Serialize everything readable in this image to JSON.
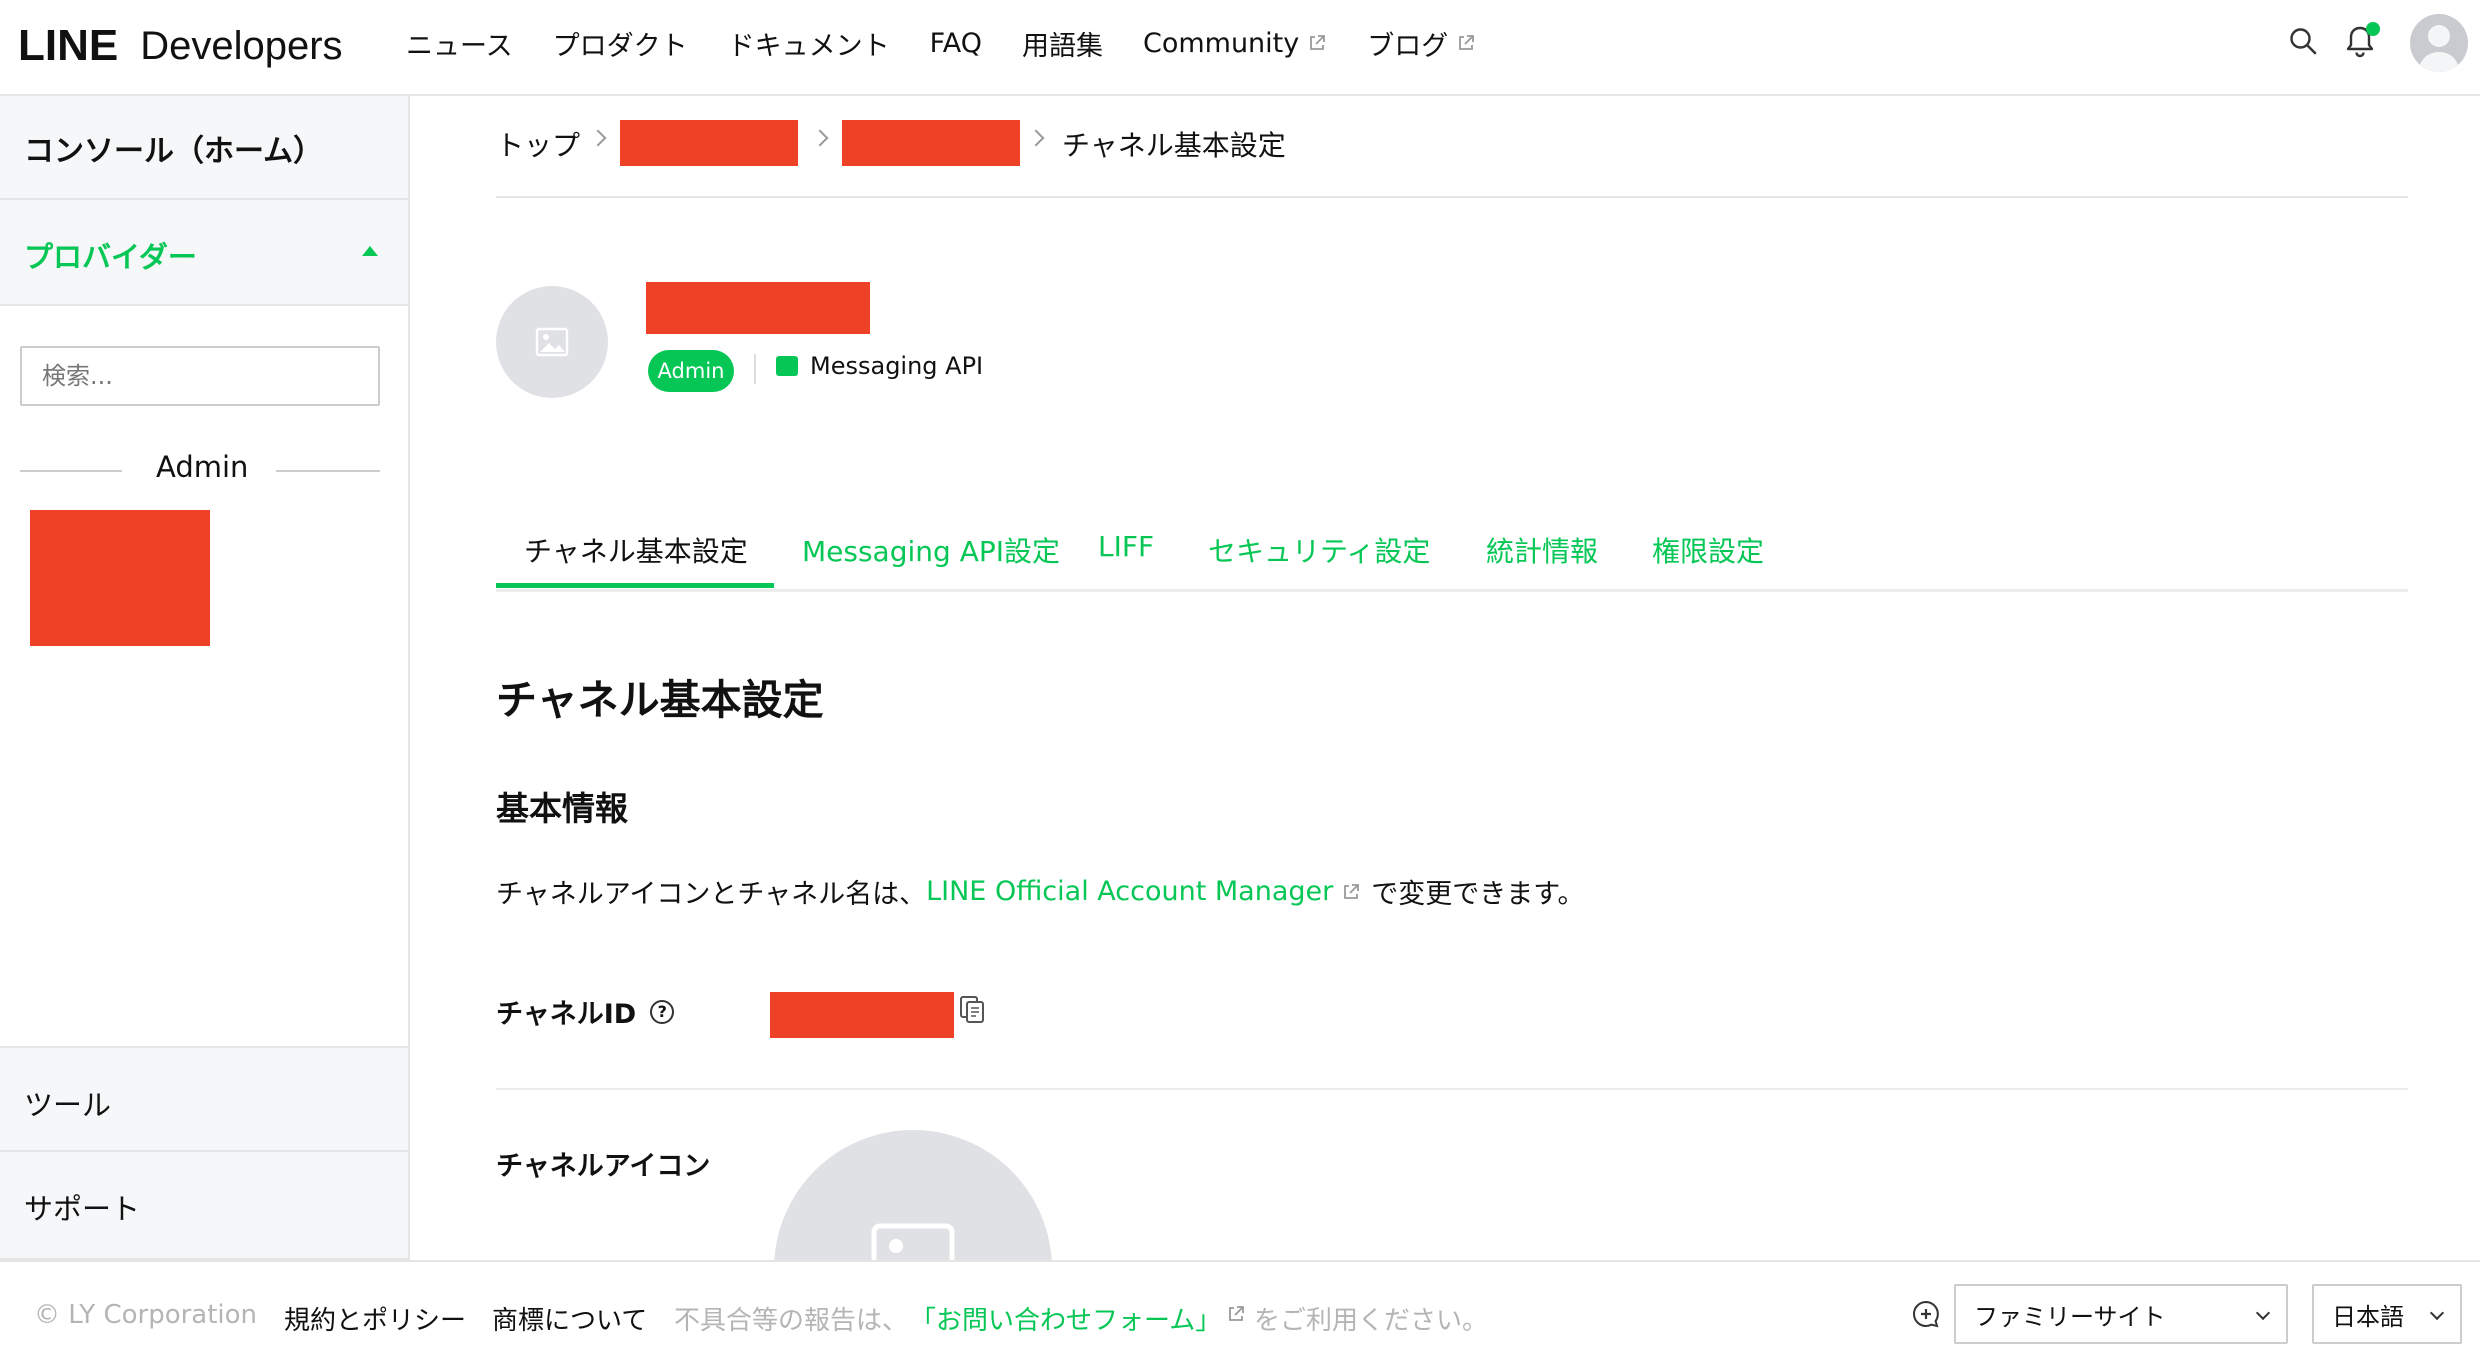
{
  "header": {
    "logo_line": "LINE",
    "logo_developers": "Developers",
    "nav": [
      "ニュース",
      "プロダクト",
      "ドキュメント",
      "FAQ",
      "用語集",
      "Community",
      "ブログ"
    ],
    "icons": [
      "search-icon",
      "bell-icon",
      "avatar-icon"
    ]
  },
  "sidebar": {
    "home": "コンソール（ホーム）",
    "providers": "プロバイダー",
    "search_placeholder": "検索...",
    "role_label": "Admin",
    "tools": "ツール",
    "support": "サポート"
  },
  "breadcrumb": {
    "top": "トップ",
    "current": "チャネル基本設定"
  },
  "channel": {
    "role_badge": "Admin",
    "type": "Messaging API"
  },
  "tabs": [
    {
      "label": "チャネル基本設定",
      "active": true
    },
    {
      "label": "Messaging API設定",
      "active": false
    },
    {
      "label": "LIFF",
      "active": false
    },
    {
      "label": "セキュリティ設定",
      "active": false
    },
    {
      "label": "統計情報",
      "active": false
    },
    {
      "label": "権限設定",
      "active": false
    }
  ],
  "content": {
    "title": "チャネル基本設定",
    "section_title": "基本情報",
    "desc_before": "チャネルアイコンとチャネル名は、",
    "desc_link": "LINE Official Account Manager",
    "desc_after": "で変更できます。",
    "channel_id_label": "チャネルID",
    "channel_icon_label": "チャネルアイコン"
  },
  "footer": {
    "copyright": "© LY Corporation",
    "terms": "規約とポリシー",
    "trademark": "商標について",
    "report_before": "不具合等の報告は、",
    "report_link": "「お問い合わせフォーム」",
    "report_after": "をご利用ください。",
    "family_site": "ファミリーサイト",
    "language": "日本語"
  },
  "colors": {
    "accent": "#06c755",
    "redaction": "#ee4126"
  }
}
